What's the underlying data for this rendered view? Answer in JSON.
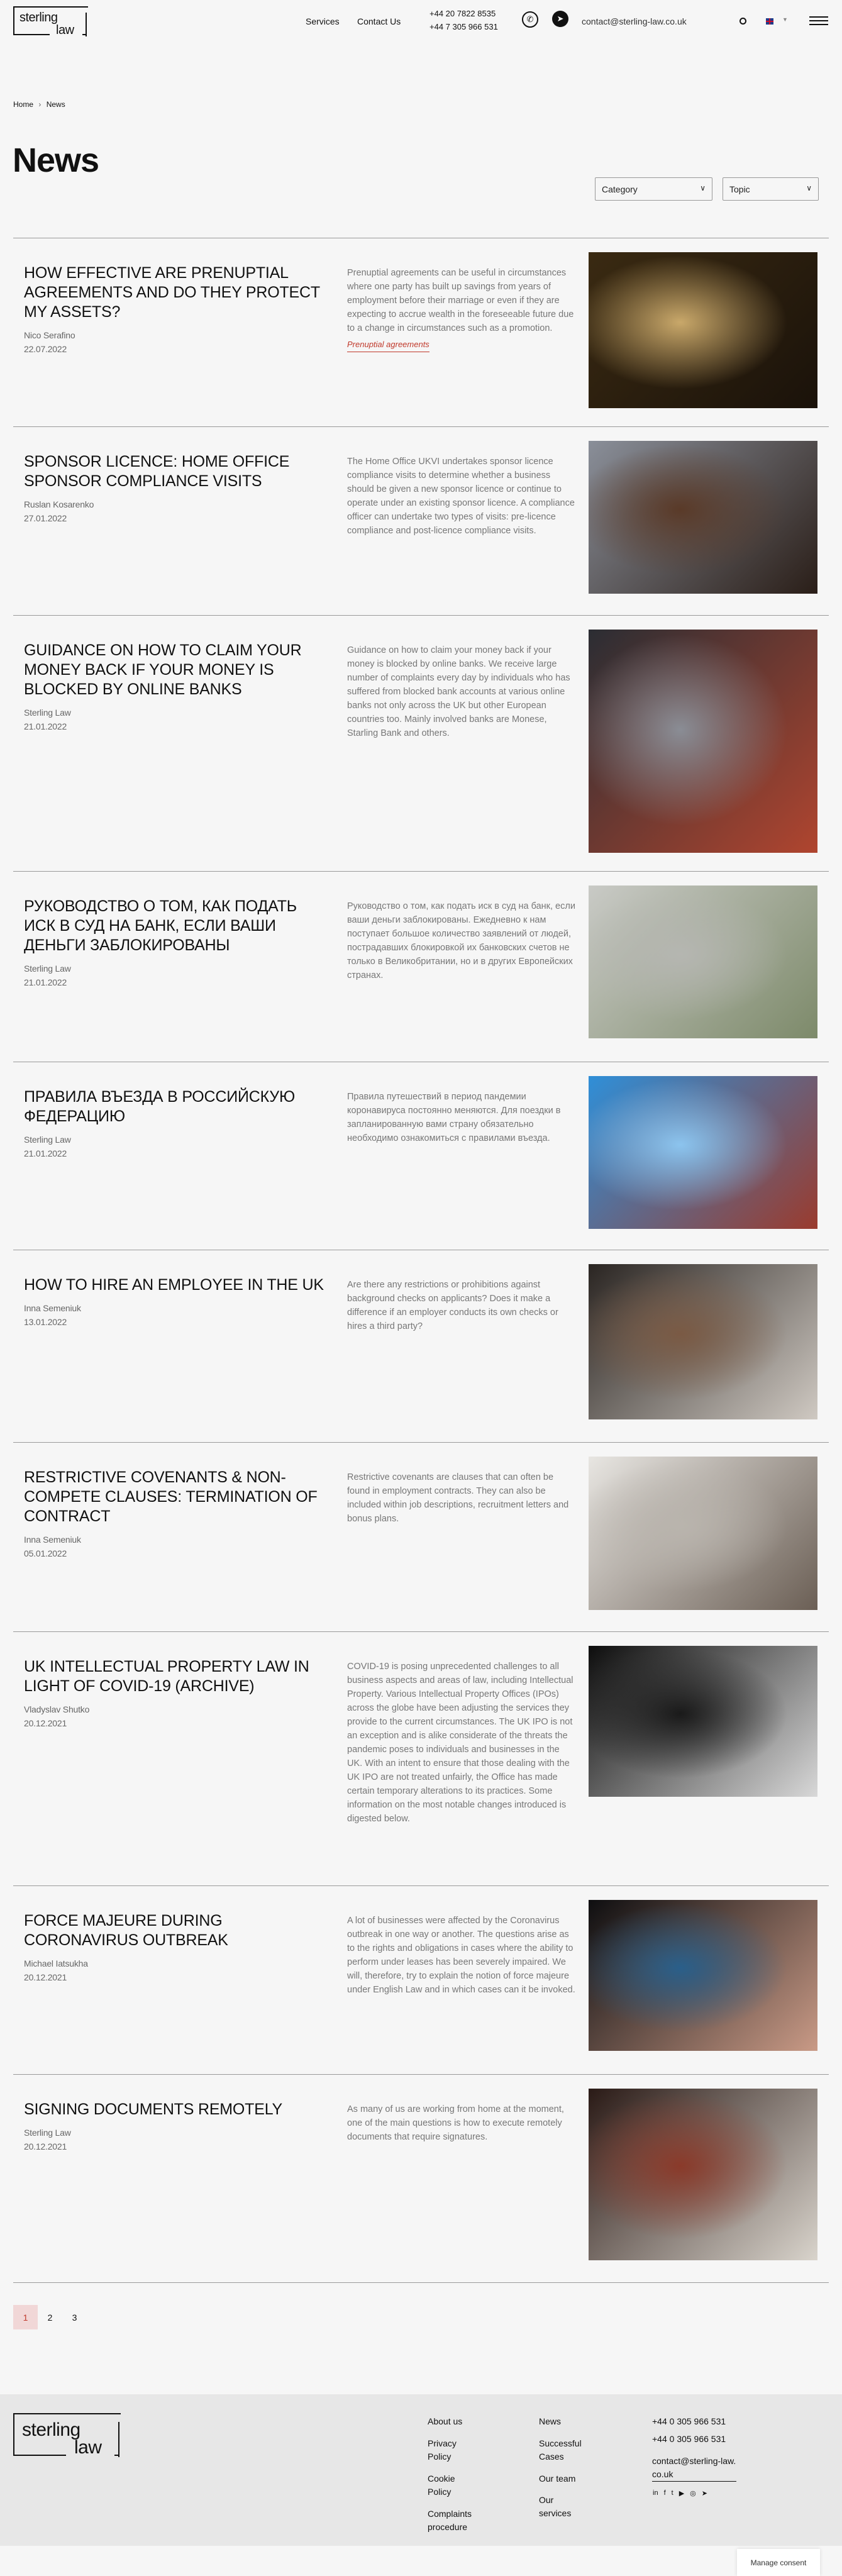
{
  "header": {
    "logo": {
      "line1": "sterling",
      "line2": "law"
    },
    "nav": [
      {
        "label": "Services"
      },
      {
        "label": "Contact Us"
      }
    ],
    "phones": [
      "+44 20 7822 8535",
      "+44 7 305 966 531"
    ],
    "email": "contact@sterling-law.co.uk",
    "icons": {
      "whatsapp": "whatsapp-icon",
      "telegram": "telegram-icon",
      "search": "search-icon",
      "language": "uk-flag-icon",
      "menu": "hamburger-icon"
    }
  },
  "breadcrumb": {
    "home": "Home",
    "separator": "›",
    "current": "News"
  },
  "page_title": "News",
  "filters": {
    "category": "Category",
    "topic": "Topic"
  },
  "articles": [
    {
      "title": "How effective are prenuptial agreements and do they protect my assets?",
      "author": "Nico Serafino",
      "date": "22.07.2022",
      "desc": "Prenuptial agreements can be useful in circumstances where one party has built up savings from years of employment before their marriage or even if they are expecting to accrue wealth in the foreseeable future due to a change in circumstances such as a promotion.",
      "tag": "Prenuptial agreements",
      "image_colors": [
        "#3a2a12",
        "#c9a86a",
        "#1a120a"
      ]
    },
    {
      "title": "Sponsor Licence: Home Office Sponsor Compliance Visits",
      "author": "Ruslan Kosarenko",
      "date": "27.01.2022",
      "desc": "The Home Office UKVI undertakes sponsor licence compliance visits to determine whether a business should be given a new sponsor licence or continue to operate under an existing sponsor licence. A compliance officer can undertake two types of visits: pre-licence compliance and post-licence compliance visits.",
      "image_colors": [
        "#8a8f99",
        "#5a3a28",
        "#2a1e18"
      ]
    },
    {
      "title": "Guidance on how to claim your money back if your money is blocked by online banks",
      "author": "Sterling Law",
      "date": "21.01.2022",
      "desc": "Guidance on how to claim your money back if your money is blocked by online banks. We receive large number of complaints every day by individuals who has suffered from blocked bank accounts at various online banks not only across the UK but other European countries too. Mainly involved banks are Monese, Starling Bank and others.",
      "image_colors": [
        "#2b2d33",
        "#8a8d95",
        "#b0452f"
      ]
    },
    {
      "title": "Руководство о том, как подать иск в суд на банк, если ваши деньги заблокированы",
      "author": "Sterling Law",
      "date": "21.01.2022",
      "desc": "Руководство о том, как подать иск в суд на банк, если ваши деньги заблокированы. Ежедневно к нам поступает большое количество заявлений от людей, пострадавших блокировкой их банковских счетов не только в Великобритании, но и в других Европейских странах.",
      "image_colors": [
        "#c9cac6",
        "#b5b6b1",
        "#7d8a6a"
      ]
    },
    {
      "title": "Правила въезда в Российскую Федерацию",
      "author": "Sterling Law",
      "date": "21.01.2022",
      "desc": "Правила путешествий в период пандемии коронавируса постоянно меняются. Для поездки в запланированную вами страну обязательно необходимо ознакомиться с правилами въезда.",
      "image_colors": [
        "#2f8fd8",
        "#8cc4ee",
        "#9a3b2e"
      ]
    },
    {
      "title": "How to hire an employee in the UK",
      "author": "Inna Semeniuk",
      "date": "13.01.2022",
      "desc": "Are there any restrictions or prohibitions against background checks on applicants? Does it make a difference if an employer conducts its own checks or hires a third party?",
      "image_colors": [
        "#2a2522",
        "#7a5a44",
        "#cfc9c2"
      ]
    },
    {
      "title": "Restrictive covenants & non-compete clauses: termination of contract",
      "author": "Inna Semeniuk",
      "date": "05.01.2022",
      "desc": "Restrictive covenants are clauses that can often be found in employment contracts. They can also be included within job descriptions, recruitment letters and bonus plans.",
      "image_colors": [
        "#e8e6e2",
        "#b9b4ad",
        "#6b5f55"
      ]
    },
    {
      "title": "UK Intellectual Property Law in light of COVID-19 (archive)",
      "author": "Vladyslav Shutko",
      "date": "20.12.2021",
      "desc": "COVID-19 is posing unprecedented challenges to all business aspects and areas of law, including Intellectual Property. Various Intellectual Property Offices (IPOs) across the globe have been adjusting the services they provide to the current circumstances. The UK IPO is not an exception and is alike considerate of the threats the pandemic poses to individuals and businesses in the UK. With an intent to ensure that those dealing with the UK IPO are not treated unfairly, the Office has made certain temporary alterations to its practices. Some information on the most notable changes introduced is digested below.",
      "image_colors": [
        "#0d0d0d",
        "#1a1a1a",
        "#d8d8d8"
      ]
    },
    {
      "title": "Force majeure during coronavirus outbreak",
      "author": "Michael Iatsukha",
      "date": "20.12.2021",
      "desc": "A lot of businesses were affected by the Coronavirus outbreak in one way or another. The questions arise as to the rights and obligations in cases where the ability to perform under leases has been severely impaired. We will, therefore, try to explain the notion of force majeure under English Law and in which cases can it be invoked.",
      "image_colors": [
        "#0e0e10",
        "#2a5f8a",
        "#c99a86"
      ]
    },
    {
      "title": "Signing documents remotely",
      "author": "Sterling Law",
      "date": "20.12.2021",
      "desc": "As many of us are working from home at the moment, one of the main questions is how to execute remotely documents that require signatures.",
      "image_colors": [
        "#2a1a16",
        "#8a3a2a",
        "#d9d4cc"
      ]
    }
  ],
  "pagination": {
    "pages": [
      "1",
      "2",
      "3"
    ],
    "current": "1"
  },
  "footer": {
    "logo": {
      "line1": "sterling",
      "line2": "law"
    },
    "col1": [
      "About us",
      "Privacy Policy",
      "Cookie Policy",
      "Complaints procedure"
    ],
    "col2": [
      "News",
      "Successful Cases",
      "Our team",
      "Our services"
    ],
    "phones": [
      "+44 0 305 966 531",
      "+44 0 305 966 531"
    ],
    "email": "contact@sterling-law.co.uk",
    "social_icons": [
      "linkedin-icon",
      "facebook-icon",
      "twitter-icon",
      "youtube-icon",
      "instagram-icon",
      "telegram-icon"
    ]
  },
  "consent": {
    "label": "Manage consent"
  },
  "colors": {
    "background": "#f6f6f6",
    "footer": "#e7e7e7",
    "accent": "#c0392b",
    "pager_active_bg": "#f1d7d7"
  }
}
